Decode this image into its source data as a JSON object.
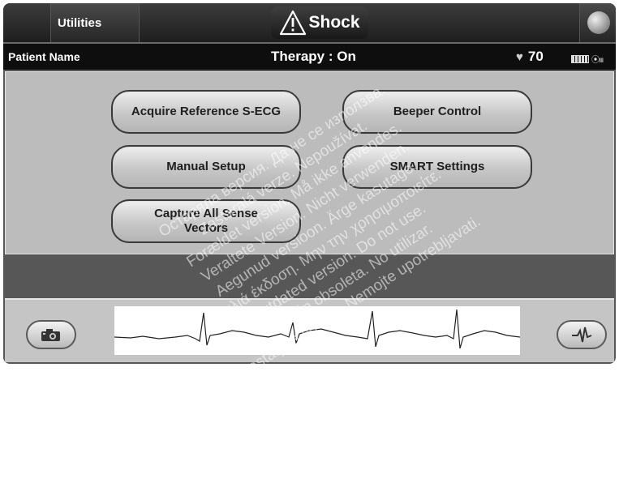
{
  "topbar": {
    "utilities_label": "Utilities",
    "shock_label": "Shock"
  },
  "statusbar": {
    "patient_name": "Patient Name",
    "therapy": "Therapy : On",
    "heart_rate": "70"
  },
  "menu": {
    "acquire_reference": "Acquire Reference S-ECG",
    "beeper_control": "Beeper Control",
    "manual_setup": "Manual Setup",
    "smart_settings": "SMART Settings",
    "capture_line1": "Capture All Sense",
    "capture_line2": "Vectors"
  },
  "watermark": [
    "Остаряла версия. Да не се използва.",
    "Zastaralá verze. Nepoužívat.",
    "Forældet version. Må ikke anvendes.",
    "Veraltete Version. Nicht verwenden.",
    "Aegunud versioon. Ärge kasutage.",
    "Παλιά έκδοση. Μην την χρησιμοποιείτε.",
    "Outdated version. Do not use.",
    "Versión obsoleta. No utilizar.",
    "Zastarjela verzija. Nemojte upotrebljavati."
  ],
  "icons": {
    "shock": "warning-triangle-icon",
    "heart": "heart-icon",
    "battery": "battery-icon",
    "signal": "telemetry-signal-icon",
    "camera": "camera-icon",
    "ecg": "ecg-trace-icon",
    "right": "programmer-wand-icon"
  }
}
